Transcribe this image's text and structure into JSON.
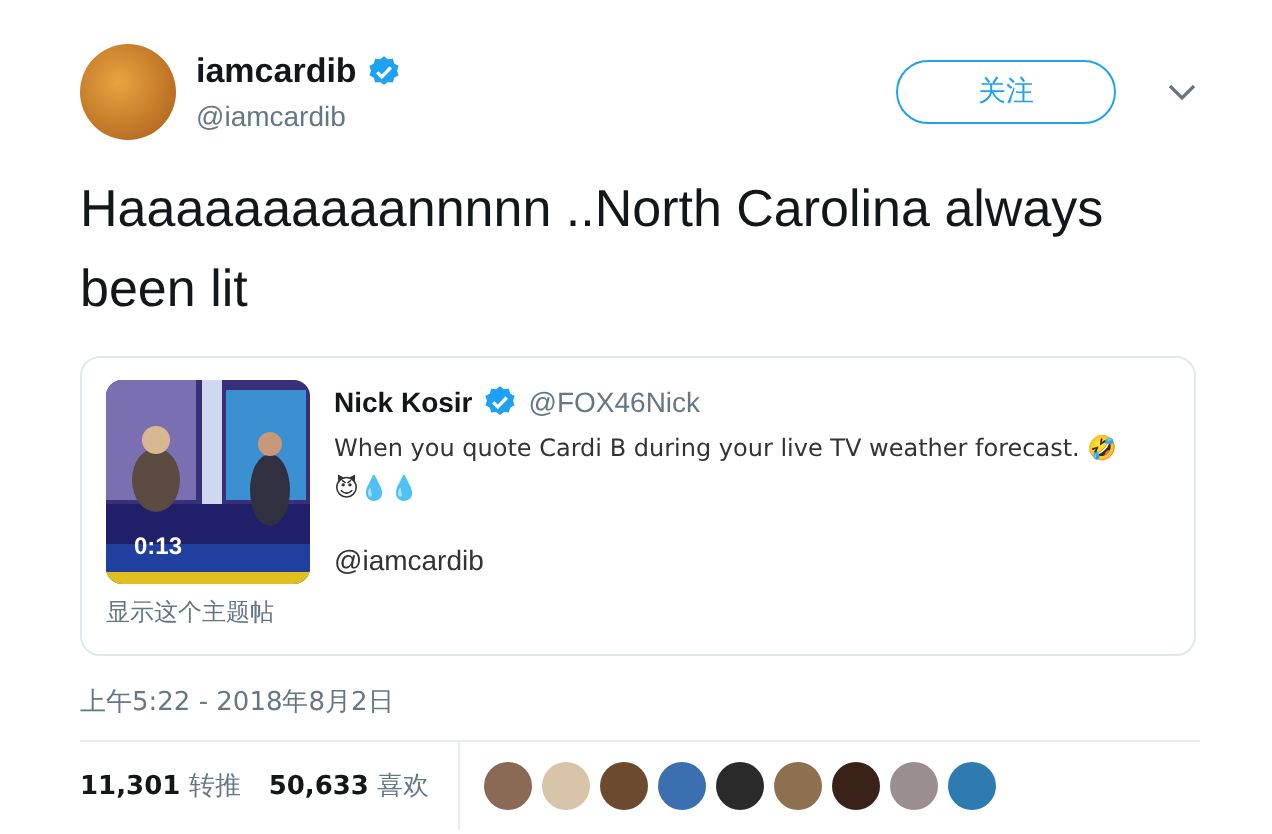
{
  "author": {
    "name": "iamcardib",
    "handle": "@iamcardib",
    "verified": true
  },
  "follow_button": {
    "label": "关注"
  },
  "tweet_text": "Haaaaaaaaaannnnn ..North Carolina always been lit",
  "quoted_tweet": {
    "video": {
      "duration": "0:13"
    },
    "name": "Nick Kosir",
    "verified": true,
    "handle": "@FOX46Nick",
    "text": "When you quote Cardi B during your live TV weather forecast. 🤣 😈💧💧",
    "mention": "@iamcardib",
    "show_thread": "显示这个主题帖"
  },
  "timestamp": "上午5:22 - 2018年8月2日",
  "stats": [
    {
      "count": "11,301",
      "label": "转推"
    },
    {
      "count": "50,633",
      "label": "喜欢"
    }
  ],
  "liked_by": [
    {
      "color": "#8a6a55"
    },
    {
      "color": "#d8c4a8"
    },
    {
      "color": "#6b4a30"
    },
    {
      "color": "#3b6fb0"
    },
    {
      "color": "#2a2a2a"
    },
    {
      "color": "#8c7050"
    },
    {
      "color": "#3a2218"
    },
    {
      "color": "#9a8e90"
    },
    {
      "color": "#2d7bb0"
    }
  ]
}
